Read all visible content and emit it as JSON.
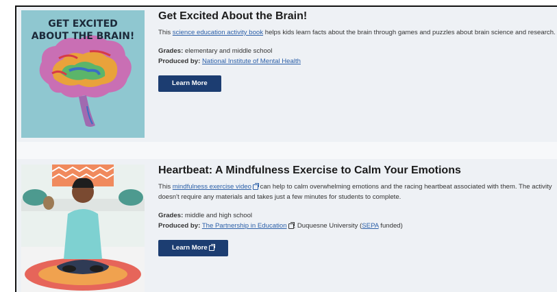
{
  "cards": [
    {
      "title": "Get Excited About the Brain!",
      "desc_pre": "This ",
      "desc_link": "science education activity book",
      "desc_post": " helps kids learn facts about the brain through games and puzzles about brain science and research.",
      "grades_label": "Grades:",
      "grades_value": " elementary and middle school",
      "producer_label": "Produced by:",
      "producer_link": "National Institute of Mental Health",
      "button": "Learn More",
      "image_text_line1": "GET EXCITED",
      "image_text_line2": "ABOUT THE BRAIN!"
    },
    {
      "title": "Heartbeat: A Mindfulness Exercise to Calm Your Emotions",
      "desc_pre": "This ",
      "desc_link": "mindfulness exercise video",
      "desc_post": " can help to calm overwhelming emotions and the racing heartbeat associated with them. The activity doesn't require any materials and takes just a few minutes for students to complete.",
      "grades_label": "Grades:",
      "grades_value": " middle and high school",
      "producer_label": "Produced by:",
      "producer_link": "The Partnership in Education",
      "producer_mid": ", Duquesne University (",
      "producer_link2": "SEPA",
      "producer_post": " funded)",
      "button": "Learn More"
    }
  ],
  "colors": {
    "button_bg": "#1c3d71",
    "link": "#2b5fa8",
    "card_bg": "#eef1f5"
  },
  "icons": {
    "external_link": "external-link-icon"
  }
}
